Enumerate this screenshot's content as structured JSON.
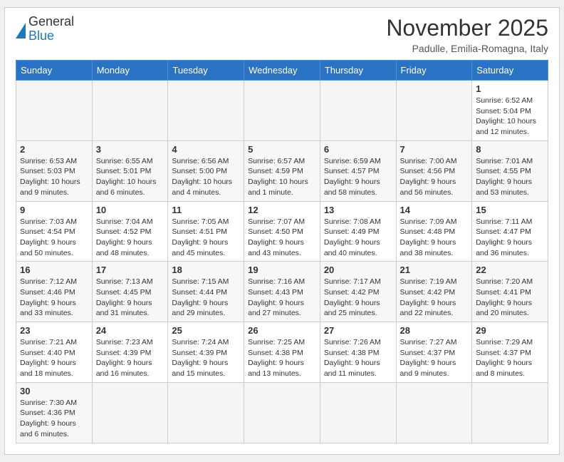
{
  "header": {
    "logo_general": "General",
    "logo_blue": "Blue",
    "month_title": "November 2025",
    "location": "Padulle, Emilia-Romagna, Italy"
  },
  "weekdays": [
    "Sunday",
    "Monday",
    "Tuesday",
    "Wednesday",
    "Thursday",
    "Friday",
    "Saturday"
  ],
  "weeks": [
    [
      {
        "day": "",
        "info": ""
      },
      {
        "day": "",
        "info": ""
      },
      {
        "day": "",
        "info": ""
      },
      {
        "day": "",
        "info": ""
      },
      {
        "day": "",
        "info": ""
      },
      {
        "day": "",
        "info": ""
      },
      {
        "day": "1",
        "info": "Sunrise: 6:52 AM\nSunset: 5:04 PM\nDaylight: 10 hours\nand 12 minutes."
      }
    ],
    [
      {
        "day": "2",
        "info": "Sunrise: 6:53 AM\nSunset: 5:03 PM\nDaylight: 10 hours\nand 9 minutes."
      },
      {
        "day": "3",
        "info": "Sunrise: 6:55 AM\nSunset: 5:01 PM\nDaylight: 10 hours\nand 6 minutes."
      },
      {
        "day": "4",
        "info": "Sunrise: 6:56 AM\nSunset: 5:00 PM\nDaylight: 10 hours\nand 4 minutes."
      },
      {
        "day": "5",
        "info": "Sunrise: 6:57 AM\nSunset: 4:59 PM\nDaylight: 10 hours\nand 1 minute."
      },
      {
        "day": "6",
        "info": "Sunrise: 6:59 AM\nSunset: 4:57 PM\nDaylight: 9 hours\nand 58 minutes."
      },
      {
        "day": "7",
        "info": "Sunrise: 7:00 AM\nSunset: 4:56 PM\nDaylight: 9 hours\nand 56 minutes."
      },
      {
        "day": "8",
        "info": "Sunrise: 7:01 AM\nSunset: 4:55 PM\nDaylight: 9 hours\nand 53 minutes."
      }
    ],
    [
      {
        "day": "9",
        "info": "Sunrise: 7:03 AM\nSunset: 4:54 PM\nDaylight: 9 hours\nand 50 minutes."
      },
      {
        "day": "10",
        "info": "Sunrise: 7:04 AM\nSunset: 4:52 PM\nDaylight: 9 hours\nand 48 minutes."
      },
      {
        "day": "11",
        "info": "Sunrise: 7:05 AM\nSunset: 4:51 PM\nDaylight: 9 hours\nand 45 minutes."
      },
      {
        "day": "12",
        "info": "Sunrise: 7:07 AM\nSunset: 4:50 PM\nDaylight: 9 hours\nand 43 minutes."
      },
      {
        "day": "13",
        "info": "Sunrise: 7:08 AM\nSunset: 4:49 PM\nDaylight: 9 hours\nand 40 minutes."
      },
      {
        "day": "14",
        "info": "Sunrise: 7:09 AM\nSunset: 4:48 PM\nDaylight: 9 hours\nand 38 minutes."
      },
      {
        "day": "15",
        "info": "Sunrise: 7:11 AM\nSunset: 4:47 PM\nDaylight: 9 hours\nand 36 minutes."
      }
    ],
    [
      {
        "day": "16",
        "info": "Sunrise: 7:12 AM\nSunset: 4:46 PM\nDaylight: 9 hours\nand 33 minutes."
      },
      {
        "day": "17",
        "info": "Sunrise: 7:13 AM\nSunset: 4:45 PM\nDaylight: 9 hours\nand 31 minutes."
      },
      {
        "day": "18",
        "info": "Sunrise: 7:15 AM\nSunset: 4:44 PM\nDaylight: 9 hours\nand 29 minutes."
      },
      {
        "day": "19",
        "info": "Sunrise: 7:16 AM\nSunset: 4:43 PM\nDaylight: 9 hours\nand 27 minutes."
      },
      {
        "day": "20",
        "info": "Sunrise: 7:17 AM\nSunset: 4:42 PM\nDaylight: 9 hours\nand 25 minutes."
      },
      {
        "day": "21",
        "info": "Sunrise: 7:19 AM\nSunset: 4:42 PM\nDaylight: 9 hours\nand 22 minutes."
      },
      {
        "day": "22",
        "info": "Sunrise: 7:20 AM\nSunset: 4:41 PM\nDaylight: 9 hours\nand 20 minutes."
      }
    ],
    [
      {
        "day": "23",
        "info": "Sunrise: 7:21 AM\nSunset: 4:40 PM\nDaylight: 9 hours\nand 18 minutes."
      },
      {
        "day": "24",
        "info": "Sunrise: 7:23 AM\nSunset: 4:39 PM\nDaylight: 9 hours\nand 16 minutes."
      },
      {
        "day": "25",
        "info": "Sunrise: 7:24 AM\nSunset: 4:39 PM\nDaylight: 9 hours\nand 15 minutes."
      },
      {
        "day": "26",
        "info": "Sunrise: 7:25 AM\nSunset: 4:38 PM\nDaylight: 9 hours\nand 13 minutes."
      },
      {
        "day": "27",
        "info": "Sunrise: 7:26 AM\nSunset: 4:38 PM\nDaylight: 9 hours\nand 11 minutes."
      },
      {
        "day": "28",
        "info": "Sunrise: 7:27 AM\nSunset: 4:37 PM\nDaylight: 9 hours\nand 9 minutes."
      },
      {
        "day": "29",
        "info": "Sunrise: 7:29 AM\nSunset: 4:37 PM\nDaylight: 9 hours\nand 8 minutes."
      }
    ],
    [
      {
        "day": "30",
        "info": "Sunrise: 7:30 AM\nSunset: 4:36 PM\nDaylight: 9 hours\nand 6 minutes."
      },
      {
        "day": "",
        "info": ""
      },
      {
        "day": "",
        "info": ""
      },
      {
        "day": "",
        "info": ""
      },
      {
        "day": "",
        "info": ""
      },
      {
        "day": "",
        "info": ""
      },
      {
        "day": "",
        "info": ""
      }
    ]
  ]
}
